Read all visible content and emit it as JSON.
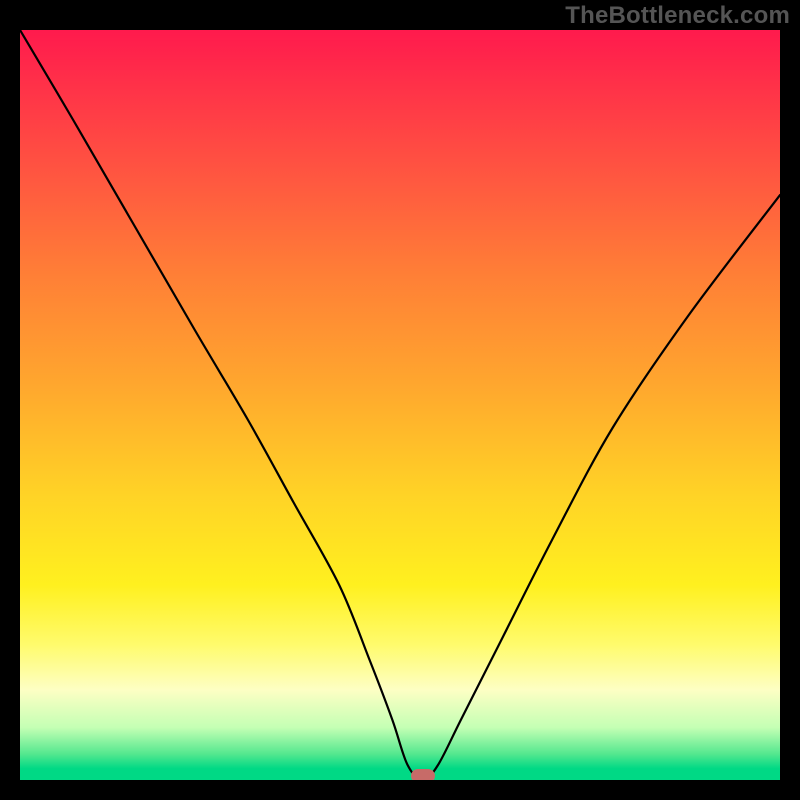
{
  "watermark": "TheBottleneck.com",
  "chart_data": {
    "type": "line",
    "title": "",
    "xlabel": "",
    "ylabel": "",
    "xlim": [
      0,
      100
    ],
    "ylim": [
      0,
      100
    ],
    "grid": false,
    "legend": false,
    "description": "Bottleneck percentage curve over a performance-heatmap gradient; minimum near x≈52.",
    "series": [
      {
        "name": "bottleneck-curve",
        "x": [
          0,
          7,
          15,
          23,
          30,
          36,
          42,
          46,
          49,
          51,
          53,
          55,
          58,
          63,
          70,
          78,
          88,
          100
        ],
        "values": [
          100,
          88,
          74,
          60,
          48,
          37,
          26,
          16,
          8,
          2,
          0,
          2,
          8,
          18,
          32,
          47,
          62,
          78
        ]
      }
    ],
    "marker": {
      "x": 53,
      "y": 0,
      "color": "#c76b68"
    },
    "gradient_stops": [
      {
        "pos": 0,
        "color": "#ff1a4d"
      },
      {
        "pos": 0.5,
        "color": "#ffc028"
      },
      {
        "pos": 0.8,
        "color": "#fff95a"
      },
      {
        "pos": 1.0,
        "color": "#00d985"
      }
    ]
  }
}
